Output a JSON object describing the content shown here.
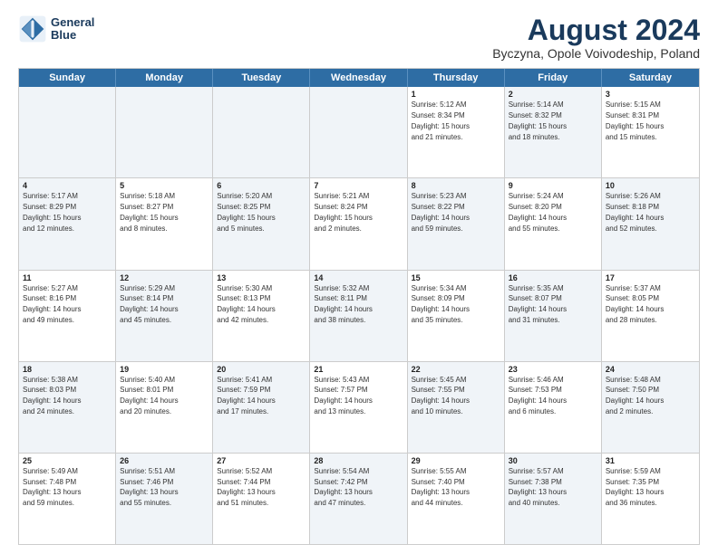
{
  "logo": {
    "line1": "General",
    "line2": "Blue"
  },
  "title": "August 2024",
  "subtitle": "Byczyna, Opole Voivodeship, Poland",
  "days_of_week": [
    "Sunday",
    "Monday",
    "Tuesday",
    "Wednesday",
    "Thursday",
    "Friday",
    "Saturday"
  ],
  "weeks": [
    [
      {
        "day": "",
        "text": "",
        "shaded": true
      },
      {
        "day": "",
        "text": "",
        "shaded": true
      },
      {
        "day": "",
        "text": "",
        "shaded": true
      },
      {
        "day": "",
        "text": "",
        "shaded": true
      },
      {
        "day": "1",
        "text": "Sunrise: 5:12 AM\nSunset: 8:34 PM\nDaylight: 15 hours\nand 21 minutes.",
        "shaded": false
      },
      {
        "day": "2",
        "text": "Sunrise: 5:14 AM\nSunset: 8:32 PM\nDaylight: 15 hours\nand 18 minutes.",
        "shaded": true
      },
      {
        "day": "3",
        "text": "Sunrise: 5:15 AM\nSunset: 8:31 PM\nDaylight: 15 hours\nand 15 minutes.",
        "shaded": false
      }
    ],
    [
      {
        "day": "4",
        "text": "Sunrise: 5:17 AM\nSunset: 8:29 PM\nDaylight: 15 hours\nand 12 minutes.",
        "shaded": true
      },
      {
        "day": "5",
        "text": "Sunrise: 5:18 AM\nSunset: 8:27 PM\nDaylight: 15 hours\nand 8 minutes.",
        "shaded": false
      },
      {
        "day": "6",
        "text": "Sunrise: 5:20 AM\nSunset: 8:25 PM\nDaylight: 15 hours\nand 5 minutes.",
        "shaded": true
      },
      {
        "day": "7",
        "text": "Sunrise: 5:21 AM\nSunset: 8:24 PM\nDaylight: 15 hours\nand 2 minutes.",
        "shaded": false
      },
      {
        "day": "8",
        "text": "Sunrise: 5:23 AM\nSunset: 8:22 PM\nDaylight: 14 hours\nand 59 minutes.",
        "shaded": true
      },
      {
        "day": "9",
        "text": "Sunrise: 5:24 AM\nSunset: 8:20 PM\nDaylight: 14 hours\nand 55 minutes.",
        "shaded": false
      },
      {
        "day": "10",
        "text": "Sunrise: 5:26 AM\nSunset: 8:18 PM\nDaylight: 14 hours\nand 52 minutes.",
        "shaded": true
      }
    ],
    [
      {
        "day": "11",
        "text": "Sunrise: 5:27 AM\nSunset: 8:16 PM\nDaylight: 14 hours\nand 49 minutes.",
        "shaded": false
      },
      {
        "day": "12",
        "text": "Sunrise: 5:29 AM\nSunset: 8:14 PM\nDaylight: 14 hours\nand 45 minutes.",
        "shaded": true
      },
      {
        "day": "13",
        "text": "Sunrise: 5:30 AM\nSunset: 8:13 PM\nDaylight: 14 hours\nand 42 minutes.",
        "shaded": false
      },
      {
        "day": "14",
        "text": "Sunrise: 5:32 AM\nSunset: 8:11 PM\nDaylight: 14 hours\nand 38 minutes.",
        "shaded": true
      },
      {
        "day": "15",
        "text": "Sunrise: 5:34 AM\nSunset: 8:09 PM\nDaylight: 14 hours\nand 35 minutes.",
        "shaded": false
      },
      {
        "day": "16",
        "text": "Sunrise: 5:35 AM\nSunset: 8:07 PM\nDaylight: 14 hours\nand 31 minutes.",
        "shaded": true
      },
      {
        "day": "17",
        "text": "Sunrise: 5:37 AM\nSunset: 8:05 PM\nDaylight: 14 hours\nand 28 minutes.",
        "shaded": false
      }
    ],
    [
      {
        "day": "18",
        "text": "Sunrise: 5:38 AM\nSunset: 8:03 PM\nDaylight: 14 hours\nand 24 minutes.",
        "shaded": true
      },
      {
        "day": "19",
        "text": "Sunrise: 5:40 AM\nSunset: 8:01 PM\nDaylight: 14 hours\nand 20 minutes.",
        "shaded": false
      },
      {
        "day": "20",
        "text": "Sunrise: 5:41 AM\nSunset: 7:59 PM\nDaylight: 14 hours\nand 17 minutes.",
        "shaded": true
      },
      {
        "day": "21",
        "text": "Sunrise: 5:43 AM\nSunset: 7:57 PM\nDaylight: 14 hours\nand 13 minutes.",
        "shaded": false
      },
      {
        "day": "22",
        "text": "Sunrise: 5:45 AM\nSunset: 7:55 PM\nDaylight: 14 hours\nand 10 minutes.",
        "shaded": true
      },
      {
        "day": "23",
        "text": "Sunrise: 5:46 AM\nSunset: 7:53 PM\nDaylight: 14 hours\nand 6 minutes.",
        "shaded": false
      },
      {
        "day": "24",
        "text": "Sunrise: 5:48 AM\nSunset: 7:50 PM\nDaylight: 14 hours\nand 2 minutes.",
        "shaded": true
      }
    ],
    [
      {
        "day": "25",
        "text": "Sunrise: 5:49 AM\nSunset: 7:48 PM\nDaylight: 13 hours\nand 59 minutes.",
        "shaded": false
      },
      {
        "day": "26",
        "text": "Sunrise: 5:51 AM\nSunset: 7:46 PM\nDaylight: 13 hours\nand 55 minutes.",
        "shaded": true
      },
      {
        "day": "27",
        "text": "Sunrise: 5:52 AM\nSunset: 7:44 PM\nDaylight: 13 hours\nand 51 minutes.",
        "shaded": false
      },
      {
        "day": "28",
        "text": "Sunrise: 5:54 AM\nSunset: 7:42 PM\nDaylight: 13 hours\nand 47 minutes.",
        "shaded": true
      },
      {
        "day": "29",
        "text": "Sunrise: 5:55 AM\nSunset: 7:40 PM\nDaylight: 13 hours\nand 44 minutes.",
        "shaded": false
      },
      {
        "day": "30",
        "text": "Sunrise: 5:57 AM\nSunset: 7:38 PM\nDaylight: 13 hours\nand 40 minutes.",
        "shaded": true
      },
      {
        "day": "31",
        "text": "Sunrise: 5:59 AM\nSunset: 7:35 PM\nDaylight: 13 hours\nand 36 minutes.",
        "shaded": false
      }
    ]
  ]
}
